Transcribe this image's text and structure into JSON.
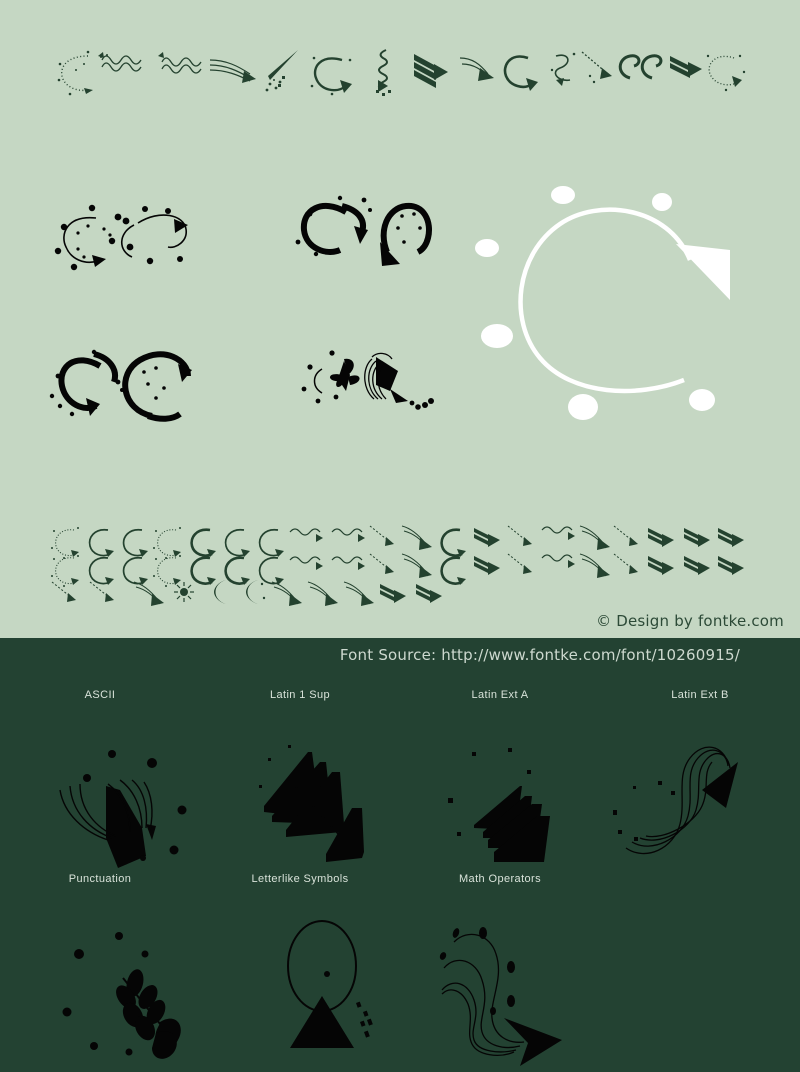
{
  "page": {
    "title": "Font specimen preview",
    "background_light": "#c5d7c3",
    "background_dark": "#234232",
    "ink_dark_green": "#24422f",
    "ink_black": "#050505",
    "ink_white": "#ffffff"
  },
  "credit": {
    "text": "© Design by fontke.com"
  },
  "source": {
    "text": "Font Source: http://www.fontke.com/font/10260915/"
  },
  "unicode_blocks": {
    "row1": [
      {
        "label": "ASCII"
      },
      {
        "label": "Latin 1 Sup"
      },
      {
        "label": "Latin Ext A"
      },
      {
        "label": "Latin Ext B"
      }
    ],
    "row2": [
      {
        "label": "Punctuation"
      },
      {
        "label": "Letterlike Symbols"
      },
      {
        "label": "Math Operators"
      },
      {
        "label": ""
      }
    ]
  },
  "specimens": {
    "top_strip_name": "dingbat-sample-strip-top",
    "large_left_row1_name": "specimen-curved-arrows-thin",
    "large_center_row1_name": "specimen-curved-arrows-bold-pair",
    "large_right_name": "specimen-white-circular-arrow",
    "large_left_row2_name": "specimen-curved-arrows-bold",
    "large_center_row2_name": "specimen-pinwheel-and-fan",
    "grid_strip_name": "dingbat-sample-grid",
    "dark_row1": [
      {
        "name": "glyph-fan-burst"
      },
      {
        "name": "glyph-triple-chevron-down"
      },
      {
        "name": "glyph-stacked-chevrons"
      },
      {
        "name": "glyph-swirl-arrow"
      }
    ],
    "dark_row2": [
      {
        "name": "glyph-leaf-arrow"
      },
      {
        "name": "glyph-oval-triangle"
      },
      {
        "name": "glyph-wave-arrow"
      },
      {
        "name": ""
      }
    ]
  }
}
